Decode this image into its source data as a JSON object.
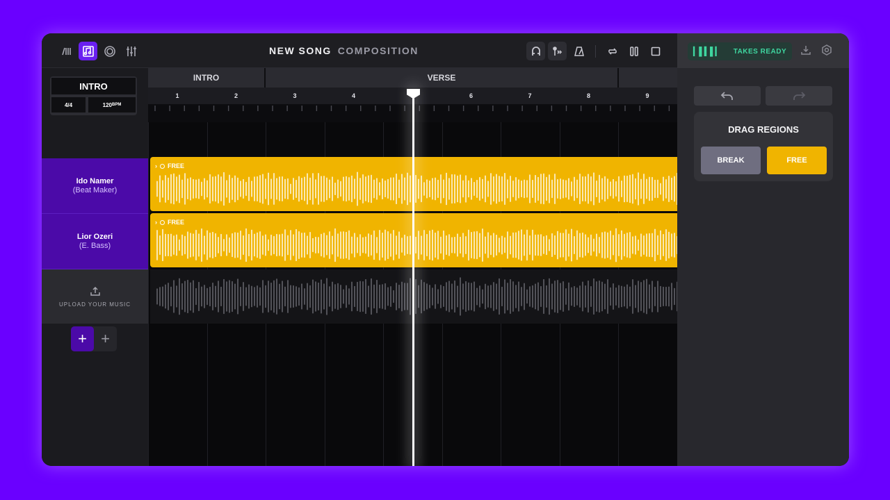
{
  "header": {
    "title": "NEW SONG",
    "subtitle": "COMPOSITION",
    "tool_icons": [
      "tracks-icon",
      "music-notes-icon",
      "disc-icon",
      "mixer-icon"
    ],
    "transport_icons": [
      "magnet-icon",
      "marker-icon",
      "metronome-icon",
      "loop-icon",
      "pause-icon",
      "stop-icon"
    ]
  },
  "right_panel": {
    "status": "TAKES READY",
    "undo_icon": "undo-icon",
    "redo_icon": "redo-icon",
    "drag_title": "DRAG REGIONS",
    "break_label": "BREAK",
    "free_label": "FREE"
  },
  "section_info": {
    "name": "INTRO",
    "time_signature": "4/4",
    "tempo": "120",
    "tempo_unit": "BPM"
  },
  "tracks": [
    {
      "name": "Ido Namer",
      "role": "(Beat Maker)",
      "region_label": "FREE"
    },
    {
      "name": "Lior Ozeri",
      "role": "(E. Bass)",
      "region_label": "FREE"
    }
  ],
  "upload": {
    "label": "UPLOAD YOUR MUSIC"
  },
  "timeline": {
    "sections": [
      "INTRO",
      "VERSE"
    ],
    "bars": [
      "1",
      "2",
      "3",
      "4",
      "5",
      "6",
      "7",
      "8",
      "9"
    ],
    "playhead_bar": 5.45
  },
  "colors": {
    "accent": "#6a1ff0",
    "region": "#f0b400",
    "status": "#3fd6a0",
    "background": "#6a00ff"
  }
}
